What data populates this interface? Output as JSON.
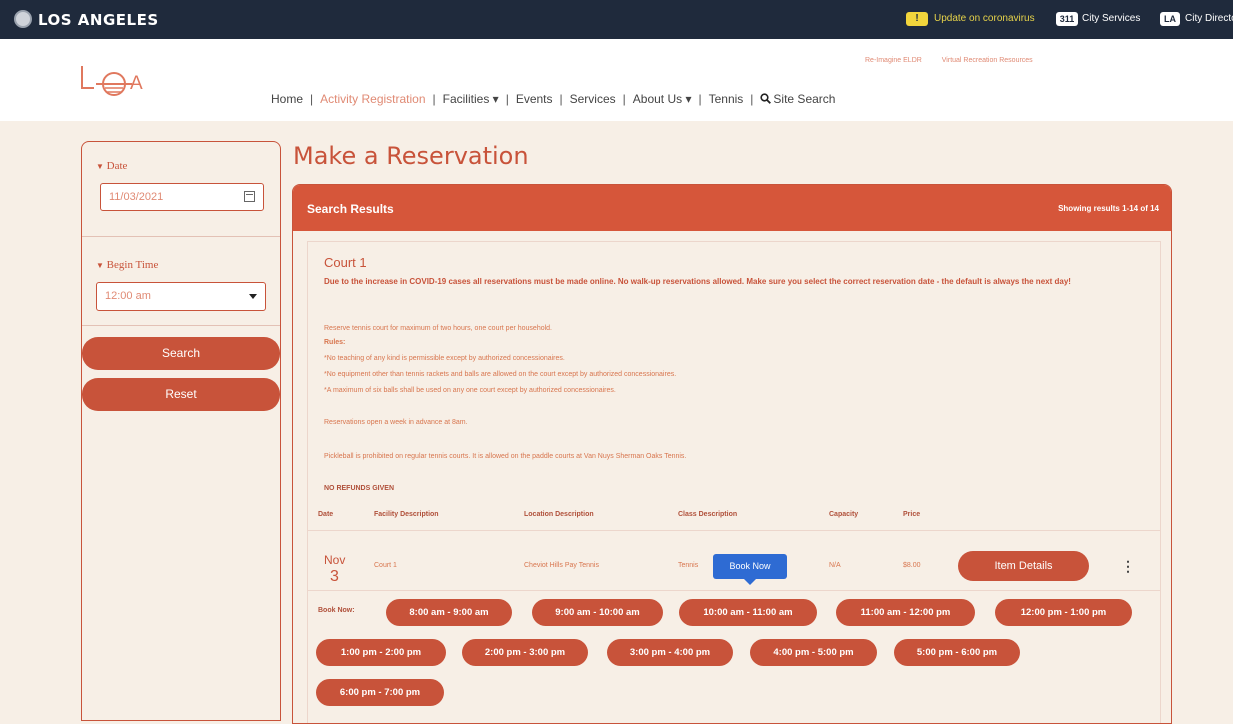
{
  "topbar": {
    "brand": "LOS ANGELES",
    "covid_badge": "!",
    "covid_link": "Update on coronavirus",
    "services_badge": "311",
    "services_link": "City Services",
    "directory_badge": "LA",
    "directory_link": "City Directory"
  },
  "header": {
    "logo_text": "A",
    "top_links": [
      "Re-Imagine ELDR",
      "Virtual Recreation Resources"
    ],
    "nav": [
      "Home",
      "Activity Registration",
      "Facilities ▾",
      "Events",
      "Services",
      "About Us ▾",
      "Tennis",
      "Site Search"
    ]
  },
  "sidebar": {
    "date_label": "Date",
    "date_value": "11/03/2021",
    "begin_time_label": "Begin Time",
    "begin_time_value": "12:00 am",
    "search_label": "Search",
    "reset_label": "Reset"
  },
  "main": {
    "title": "Make a Reservation",
    "panel_title": "Search Results",
    "results_count": "Showing results 1-14 of 14",
    "court_name": "Court 1",
    "warning": "Due to the increase in COVID-19 cases all reservations must be made online. No walk-up reservations allowed. Make sure you select the correct reservation date - the default is always the next day!",
    "reserve_line": "Reserve tennis court for maximum of two hours, one court per household.",
    "rules_label": "Rules:",
    "rules": [
      "*No teaching of any kind is permissible except by authorized concessionaires.",
      "*No equipment other than tennis rackets and balls are allowed on the court except by authorized concessionaires.",
      "*A maximum of six balls shall be used on any one court except by authorized concessionaires."
    ],
    "opens_line": "Reservations open a week in advance at 8am.",
    "pickleball_line": "Pickleball is prohibited on regular tennis courts. It is allowed on the paddle courts at Van Nuys Sherman Oaks Tennis.",
    "no_refunds": "NO REFUNDS GIVEN",
    "columns": [
      "Date",
      "Facility Description",
      "Location Description",
      "Class Description",
      "Capacity",
      "Price"
    ],
    "row": {
      "month": "Nov",
      "day": "3",
      "facility": "Court 1",
      "location": "Cheviot Hills Pay Tennis",
      "class": "Tennis",
      "capacity": "N/A",
      "price": "$8.00"
    },
    "item_details_label": "Item Details",
    "tooltip": "Book Now",
    "book_now_label": "Book Now:",
    "slots": [
      "8:00 am - 9:00 am",
      "9:00 am - 10:00 am",
      "10:00 am - 11:00 am",
      "11:00 am - 12:00 pm",
      "12:00 pm - 1:00 pm",
      "1:00 pm - 2:00 pm",
      "2:00 pm - 3:00 pm",
      "3:00 pm - 4:00 pm",
      "4:00 pm - 5:00 pm",
      "5:00 pm - 6:00 pm",
      "6:00 pm - 7:00 pm"
    ]
  },
  "colors": {
    "accent": "#c8533a",
    "topbar": "#1f2a3c",
    "background": "#f7efe6",
    "tooltip": "#2e6bd3"
  }
}
